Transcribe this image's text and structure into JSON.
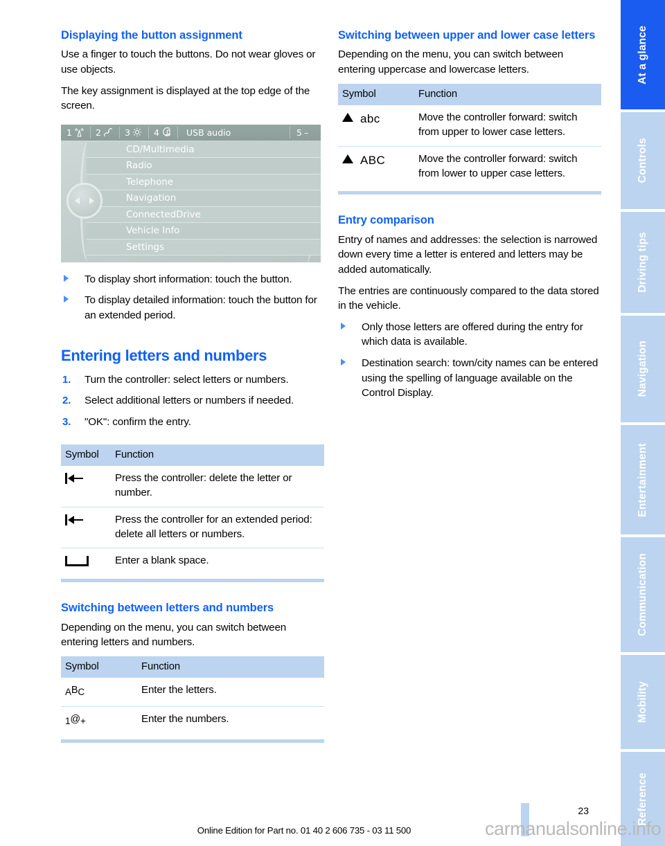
{
  "left_column": {
    "heading_1": "Displaying the button assignment",
    "paragraphs_1": [
      "Use a finger to touch the buttons. Do not wear gloves or use objects.",
      "The key assignment is displayed at the top edge of the screen."
    ],
    "idrive": {
      "topbar": {
        "item1_num": "1",
        "item1_icon": "antenna-signal-icon",
        "item2_num": "2",
        "item2_icon": "phone-handset-icon",
        "item3_num": "3",
        "item3_icon": "gear-icon",
        "item4_num": "4",
        "item4_icon": "music-note-icon",
        "source_label": "USB audio",
        "item5_num": "5",
        "item5_icon": "dash-icon",
        "item5_symbol": "–"
      },
      "menu_items": [
        "CD/Multimedia",
        "Radio",
        "Telephone",
        "Navigation",
        "ConnectedDrive",
        "Vehicle Info",
        "Settings"
      ]
    },
    "bullets_1": [
      "To display short information: touch the button.",
      "To display detailed information: touch the button for an extended period."
    ],
    "heading_2": "Entering letters and numbers",
    "steps": [
      {
        "num": "1.",
        "text": "Turn the controller: select letters or numbers."
      },
      {
        "num": "2.",
        "text": "Select additional letters or numbers if needed."
      },
      {
        "num": "3.",
        "text": "\"OK\": confirm the entry."
      }
    ],
    "table_1": {
      "headers": [
        "Symbol",
        "Function"
      ],
      "rows": [
        {
          "symbol_icon": "backspace-delete-icon",
          "function": "Press the controller: delete the letter or number."
        },
        {
          "symbol_icon": "backspace-delete-icon",
          "function": "Press the controller for an extended period: delete all letters or numbers."
        },
        {
          "symbol_icon": "space-bar-icon",
          "function": "Enter a blank space."
        }
      ]
    },
    "heading_3": "Switching between letters and numbers",
    "paragraph_3": "Depending on the menu, you can switch between entering letters and numbers.",
    "table_2": {
      "headers": [
        "Symbol",
        "Function"
      ],
      "rows": [
        {
          "symbol_text": "ABC",
          "symbol_icon": "letters-abc-icon",
          "function": "Enter the letters."
        },
        {
          "symbol_text": "1@+",
          "symbol_icon": "numbers-symbols-icon",
          "function": "Enter the numbers."
        }
      ]
    }
  },
  "right_column": {
    "heading_1": "Switching between upper and lower case letters",
    "paragraph_1": "Depending on the menu, you can switch between entering uppercase and lowercase letters.",
    "table_1": {
      "headers": [
        "Symbol",
        "Function"
      ],
      "rows": [
        {
          "symbol_icon": "triangle-up-icon",
          "symbol_text": "abc",
          "function": "Move the controller forward: switch from upper to lower case letters."
        },
        {
          "symbol_icon": "triangle-up-icon",
          "symbol_text": "ABC",
          "function": "Move the controller forward: switch from lower to upper case letters."
        }
      ]
    },
    "heading_2": "Entry comparison",
    "paragraphs_2": [
      "Entry of names and addresses: the selection is narrowed down every time a letter is entered and letters may be added automatically.",
      "The entries are continuously compared to the data stored in the vehicle."
    ],
    "bullets_2": [
      "Only those letters are offered during the entry for which data is available.",
      "Destination search: town/city names can be entered using the spelling of language available on the Control Display."
    ]
  },
  "sidebar": {
    "tabs": [
      {
        "label": "At a glance",
        "active": true
      },
      {
        "label": "Controls",
        "active": false
      },
      {
        "label": "Driving tips",
        "active": false
      },
      {
        "label": "Navigation",
        "active": false
      },
      {
        "label": "Entertainment",
        "active": false
      },
      {
        "label": "Communication",
        "active": false
      },
      {
        "label": "Mobility",
        "active": false
      },
      {
        "label": "Reference",
        "active": false
      }
    ]
  },
  "footer": {
    "page_number": "23",
    "edition_line": "Online Edition for Part no. 01 40 2 606 735 - 03 11 500",
    "watermark": "carmanualsonline.info"
  },
  "colors": {
    "accent_blue": "#1061f5",
    "tab_active": "#1b5cf0",
    "tab_inactive": "#bcd4ef",
    "table_header": "#bcd4ef",
    "table_rule": "#cfdff2"
  }
}
